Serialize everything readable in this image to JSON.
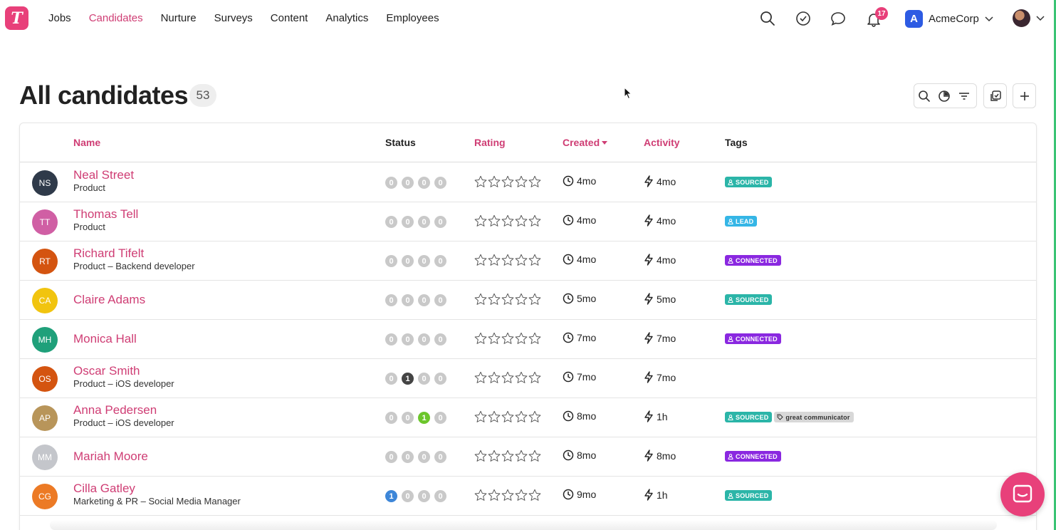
{
  "logo": {
    "letter": "T"
  },
  "nav": {
    "items": [
      "Jobs",
      "Candidates",
      "Nurture",
      "Surveys",
      "Content",
      "Analytics",
      "Employees"
    ],
    "active": "Candidates"
  },
  "notifications": {
    "count": "17"
  },
  "org": {
    "initial": "A",
    "name": "AcmeCorp"
  },
  "page": {
    "title": "All candidates",
    "count": "53"
  },
  "table": {
    "headers": {
      "name": "Name",
      "status": "Status",
      "rating": "Rating",
      "created": "Created",
      "activity": "Activity",
      "tags": "Tags"
    },
    "sorted_by": "Created",
    "rows": [
      {
        "initials": "NS",
        "avatar_color": "#2f3a4a",
        "name": "Neal Street",
        "sub": "Product",
        "status": [
          "0",
          "0",
          "0",
          "0"
        ],
        "status_active": [],
        "created": "4mo",
        "activity": "4mo",
        "tags": [
          {
            "label": "SOURCED",
            "type": "sourced"
          }
        ]
      },
      {
        "initials": "TT",
        "avatar_color": "#d05fa4",
        "name": "Thomas Tell",
        "sub": "Product",
        "status": [
          "0",
          "0",
          "0",
          "0"
        ],
        "status_active": [],
        "created": "4mo",
        "activity": "4mo",
        "tags": [
          {
            "label": "LEAD",
            "type": "lead"
          }
        ]
      },
      {
        "initials": "RT",
        "avatar_color": "#d45410",
        "name": "Richard Tifelt",
        "sub": "Product – Backend developer",
        "status": [
          "0",
          "0",
          "0",
          "0"
        ],
        "status_active": [],
        "created": "4mo",
        "activity": "4mo",
        "tags": [
          {
            "label": "CONNECTED",
            "type": "connected"
          }
        ]
      },
      {
        "initials": "CA",
        "avatar_color": "#f1c40f",
        "name": "Claire Adams",
        "sub": "",
        "status": [
          "0",
          "0",
          "0",
          "0"
        ],
        "status_active": [],
        "created": "5mo",
        "activity": "5mo",
        "tags": [
          {
            "label": "SOURCED",
            "type": "sourced"
          }
        ]
      },
      {
        "initials": "MH",
        "avatar_color": "#1fa07a",
        "name": "Monica Hall",
        "sub": "",
        "status": [
          "0",
          "0",
          "0",
          "0"
        ],
        "status_active": [],
        "created": "7mo",
        "activity": "7mo",
        "tags": [
          {
            "label": "CONNECTED",
            "type": "connected"
          }
        ]
      },
      {
        "initials": "OS",
        "avatar_color": "#d45410",
        "name": "Oscar Smith",
        "sub": "Product – iOS developer",
        "status": [
          "0",
          "1",
          "0",
          "0"
        ],
        "status_active": [
          {
            "index": 1,
            "color": "#444444"
          }
        ],
        "created": "7mo",
        "activity": "7mo",
        "tags": []
      },
      {
        "initials": "AP",
        "avatar_color": "#b8955a",
        "name": "Anna Pedersen",
        "sub": "Product – iOS developer",
        "status": [
          "0",
          "0",
          "1",
          "0"
        ],
        "status_active": [
          {
            "index": 2,
            "color": "#6cc62b"
          }
        ],
        "created": "8mo",
        "activity": "1h",
        "tags": [
          {
            "label": "SOURCED",
            "type": "sourced"
          },
          {
            "label": "great communicator",
            "type": "custom"
          }
        ]
      },
      {
        "initials": "MM",
        "avatar_color": "#c4c6cb",
        "name": "Mariah Moore",
        "sub": "",
        "status": [
          "0",
          "0",
          "0",
          "0"
        ],
        "status_active": [],
        "created": "8mo",
        "activity": "8mo",
        "tags": [
          {
            "label": "CONNECTED",
            "type": "connected"
          }
        ]
      },
      {
        "initials": "CG",
        "avatar_color": "#ec7a25",
        "name": "Cilla Gatley",
        "sub": "Marketing & PR – Social Media Manager",
        "status": [
          "1",
          "0",
          "0",
          "0"
        ],
        "status_active": [
          {
            "index": 0,
            "color": "#3d86d8"
          }
        ],
        "created": "9mo",
        "activity": "1h",
        "tags": [
          {
            "label": "SOURCED",
            "type": "sourced"
          }
        ]
      }
    ]
  },
  "colors": {
    "brand": "#e8407a",
    "link": "#cf3d74",
    "success_strip": "#3ac374"
  }
}
